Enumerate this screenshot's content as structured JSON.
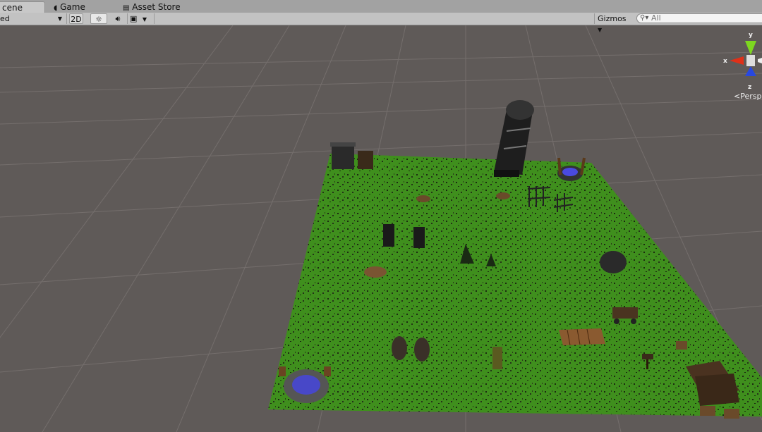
{
  "tabs": [
    {
      "label": "cene",
      "active": true
    },
    {
      "label": "Game",
      "active": false
    },
    {
      "label": "Asset Store",
      "active": false
    }
  ],
  "toolbar": {
    "shading_mode": "ed",
    "btn_2d": "2D",
    "gizmos": "Gizmos",
    "search_placeholder": "All"
  },
  "gizmo": {
    "x": "x",
    "y": "y",
    "z": "z",
    "projection": "Persp"
  },
  "colors": {
    "sky": "#5f5a58",
    "grass": "#3f8f1d",
    "grid": "#7a7574",
    "tab_bg": "#a2a2a2",
    "toolbar_bg": "#c2c2c2"
  }
}
